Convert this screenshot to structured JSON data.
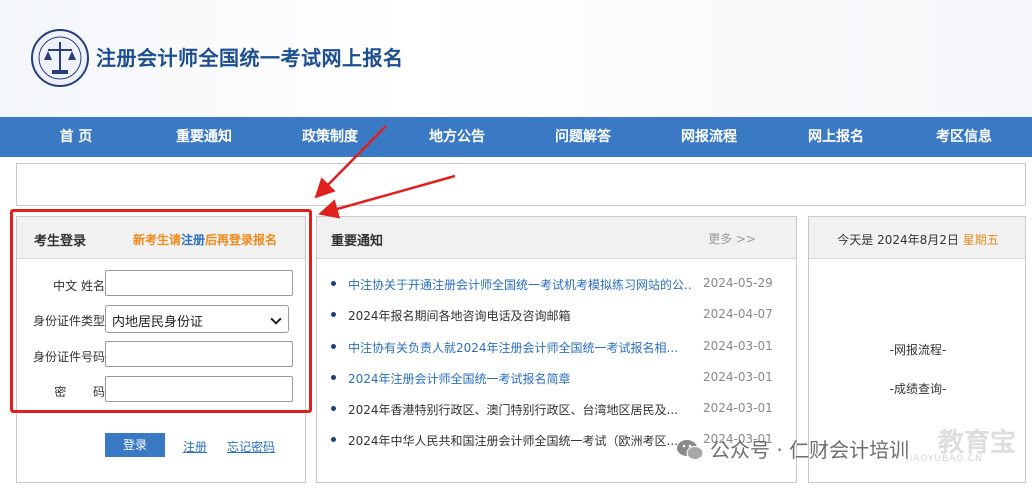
{
  "header": {
    "title": "注册会计师全国统一考试网上报名"
  },
  "nav": {
    "items": [
      "首 页",
      "重要通知",
      "政策制度",
      "地方公告",
      "问题解答",
      "网报流程",
      "网上报名",
      "考区信息"
    ]
  },
  "login": {
    "title": "考生登录",
    "tip_prefix": "新考生请",
    "tip_link": "注册",
    "tip_suffix": "后再登录报名",
    "fields": [
      {
        "label": "中文  姓名",
        "value": ""
      },
      {
        "label": "身份证件类型",
        "value": "内地居民身份证"
      },
      {
        "label": "身份证件号码",
        "value": ""
      },
      {
        "label": "密       码",
        "value": ""
      }
    ],
    "login_button": "登录",
    "register_link": "注册",
    "forgot_link": "忘记密码"
  },
  "notices": {
    "title": "重要通知",
    "more": "更多 >>",
    "items": [
      {
        "text": "中注协关于开通注册会计师全国统一考试机考模拟练习网站的公...",
        "date": "2024-05-29",
        "linked": true
      },
      {
        "text": "2024年报名期间各地咨询电话及咨询邮箱",
        "date": "2024-04-07",
        "linked": false
      },
      {
        "text": "中注协有关负责人就2024年注册会计师全国统一考试报名相...",
        "date": "2024-03-01",
        "linked": true
      },
      {
        "text": "2024年注册会计师全国统一考试报名简章",
        "date": "2024-03-01",
        "linked": true
      },
      {
        "text": "2024年香港特别行政区、澳门特别行政区、台湾地区居民及...",
        "date": "2024-03-01",
        "linked": false
      },
      {
        "text": "2024年中华人民共和国注册会计师全国统一考试（欧洲考区...",
        "date": "2024-03-01",
        "linked": false
      }
    ]
  },
  "side": {
    "date_prefix": "今天是 2024年8月2日 ",
    "weekday": "星期五",
    "links": [
      "-网报流程-",
      "-成绩查询-"
    ]
  },
  "watermark": {
    "text": "公众号 · 仁财会计培训",
    "ghost": "教育宝",
    "ghost_sub": "JIAOYUBAO.CN"
  },
  "colors": {
    "nav": "#3a7ac5",
    "title": "#1d4e8f",
    "accent": "#f08a1a",
    "link": "#2a6fc0",
    "annotation": "#e0201c"
  }
}
